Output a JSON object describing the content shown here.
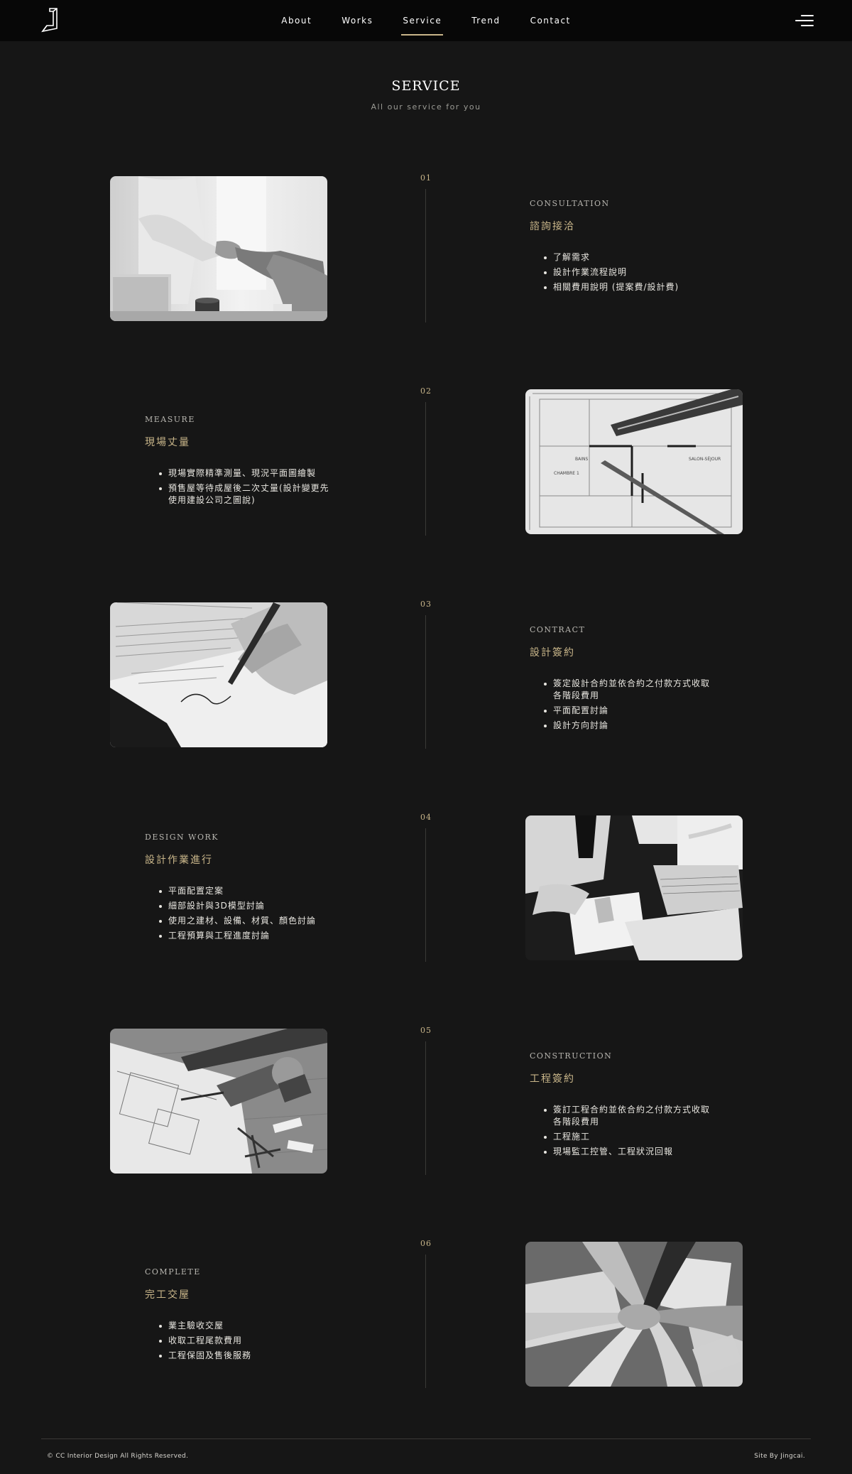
{
  "header": {
    "logo_label": "J",
    "nav": [
      {
        "label": "About"
      },
      {
        "label": "Works"
      },
      {
        "label": "Service",
        "active": true
      },
      {
        "label": "Trend"
      },
      {
        "label": "Contact"
      }
    ],
    "menu_icon": "hamburger-icon"
  },
  "page": {
    "title": "SERVICE",
    "subtitle": "All our service for you"
  },
  "steps": [
    {
      "number": "01",
      "en": "CONSULTATION",
      "zh": "諮詢接洽",
      "items": [
        "了解需求",
        "設計作業流程說明",
        "相關費用說明 (提案費/設計費)"
      ],
      "photo": "handshake-photo"
    },
    {
      "number": "02",
      "en": "MEASURE",
      "zh": "現場丈量",
      "items": [
        "現場實際精準測量、現況平面圖繪製",
        "預售屋等待成屋後二次丈量(設計變更先使用建設公司之圖說)"
      ],
      "photo": "floor-plan-photo"
    },
    {
      "number": "03",
      "en": "CONTRACT",
      "zh": "設計簽約",
      "items": [
        "簽定設計合約並依合約之付款方式收取各階段費用",
        "平面配置討論",
        "設計方向討論"
      ],
      "photo": "signing-photo"
    },
    {
      "number": "04",
      "en": "DESIGN WORK",
      "zh": "設計作業進行",
      "items": [
        "平面配置定案",
        "細部設計與3D模型討論",
        "使用之建材、設備、材質、顏色討論",
        "工程預算與工程進度討論"
      ],
      "photo": "meeting-laptop-photo"
    },
    {
      "number": "05",
      "en": "CONSTRUCTION",
      "zh": "工程簽約",
      "items": [
        "簽訂工程合約並依合約之付款方式收取各階段費用",
        "工程施工",
        "現場監工控管、工程狀況回報"
      ],
      "photo": "tools-blueprint-photo"
    },
    {
      "number": "06",
      "en": "COMPLETE",
      "zh": "完工交屋",
      "items": [
        "業主驗收交屋",
        "收取工程尾款費用",
        "工程保固及售後服務"
      ],
      "photo": "team-hands-photo"
    }
  ],
  "footer": {
    "copyright": "© CC Interior Design All Rights Reserved.",
    "credit": "Site By Jingcai."
  },
  "colors": {
    "background": "#161616",
    "header": "#070707",
    "accent": "#c9b68a",
    "text": "#e8e6e0"
  }
}
